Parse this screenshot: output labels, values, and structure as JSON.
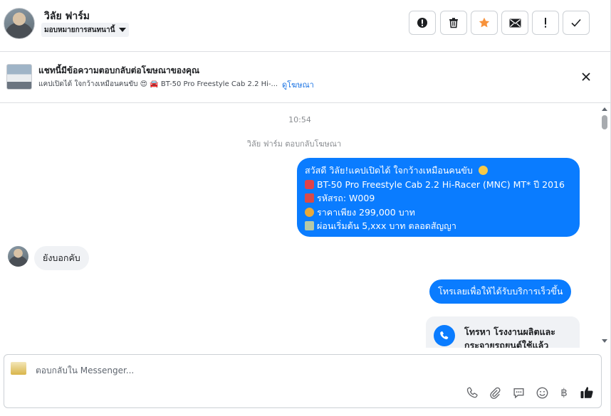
{
  "header": {
    "contact_name": "วิลัย ฟาร์ม",
    "assign_label": "มอบหมายการสนทนานี้"
  },
  "ad_banner": {
    "title": "แชทนี้มีข้อความตอบกลับต่อโฆษณาของคุณ",
    "subtitle": "แคปเปิดได้ ใจกว้างเหมือนคนขับ 😍  🚘 BT-50 Pro Freestyle Cab 2.2 Hi-...",
    "link_label": "ดูโฆษณา"
  },
  "conversation": {
    "timestamp": "10:54",
    "event_text": "วิลัย ฟาร์ม ตอบกลับโฆษณา",
    "ad_message": {
      "lines": [
        "สวัสดี วิลัย!แคปเปิดได้ ใจกว้างเหมือนคนขับ",
        "BT-50 Pro Freestyle Cab 2.2 Hi-Racer (MNC) MT* ปี 2016",
        "รหัสรถ: W009",
        "ราคาเพียง 299,000 บาท",
        "ผ่อนเริ่มต้น 5,xxx บาท ตลอดสัญญา"
      ]
    },
    "incoming_message": "ยังบอกคับ",
    "outgoing_message": "โทรเลยเพื่อให้ได้รับบริการเร็วขึ้น",
    "call_card_text": "โทรหา โรงงานผลิตและกระจายรถยนต์ใช้แล้ว"
  },
  "composer": {
    "placeholder": "ตอบกลับใน Messenger...",
    "currency_symbol": "฿"
  },
  "colors": {
    "accent_blue": "#0a7cff",
    "star_orange": "#f7923b",
    "bubble_grey": "#f0f2f5",
    "link_blue": "#1b74e4"
  },
  "icons": {
    "header_actions": [
      "alert-circle-icon",
      "trash-icon",
      "star-icon",
      "mail-icon",
      "exclamation-icon",
      "check-icon"
    ],
    "composer_tools": [
      "phone-icon",
      "paperclip-icon",
      "chat-bubble-icon",
      "smiley-icon",
      "baht-icon",
      "thumbs-up-icon"
    ]
  }
}
